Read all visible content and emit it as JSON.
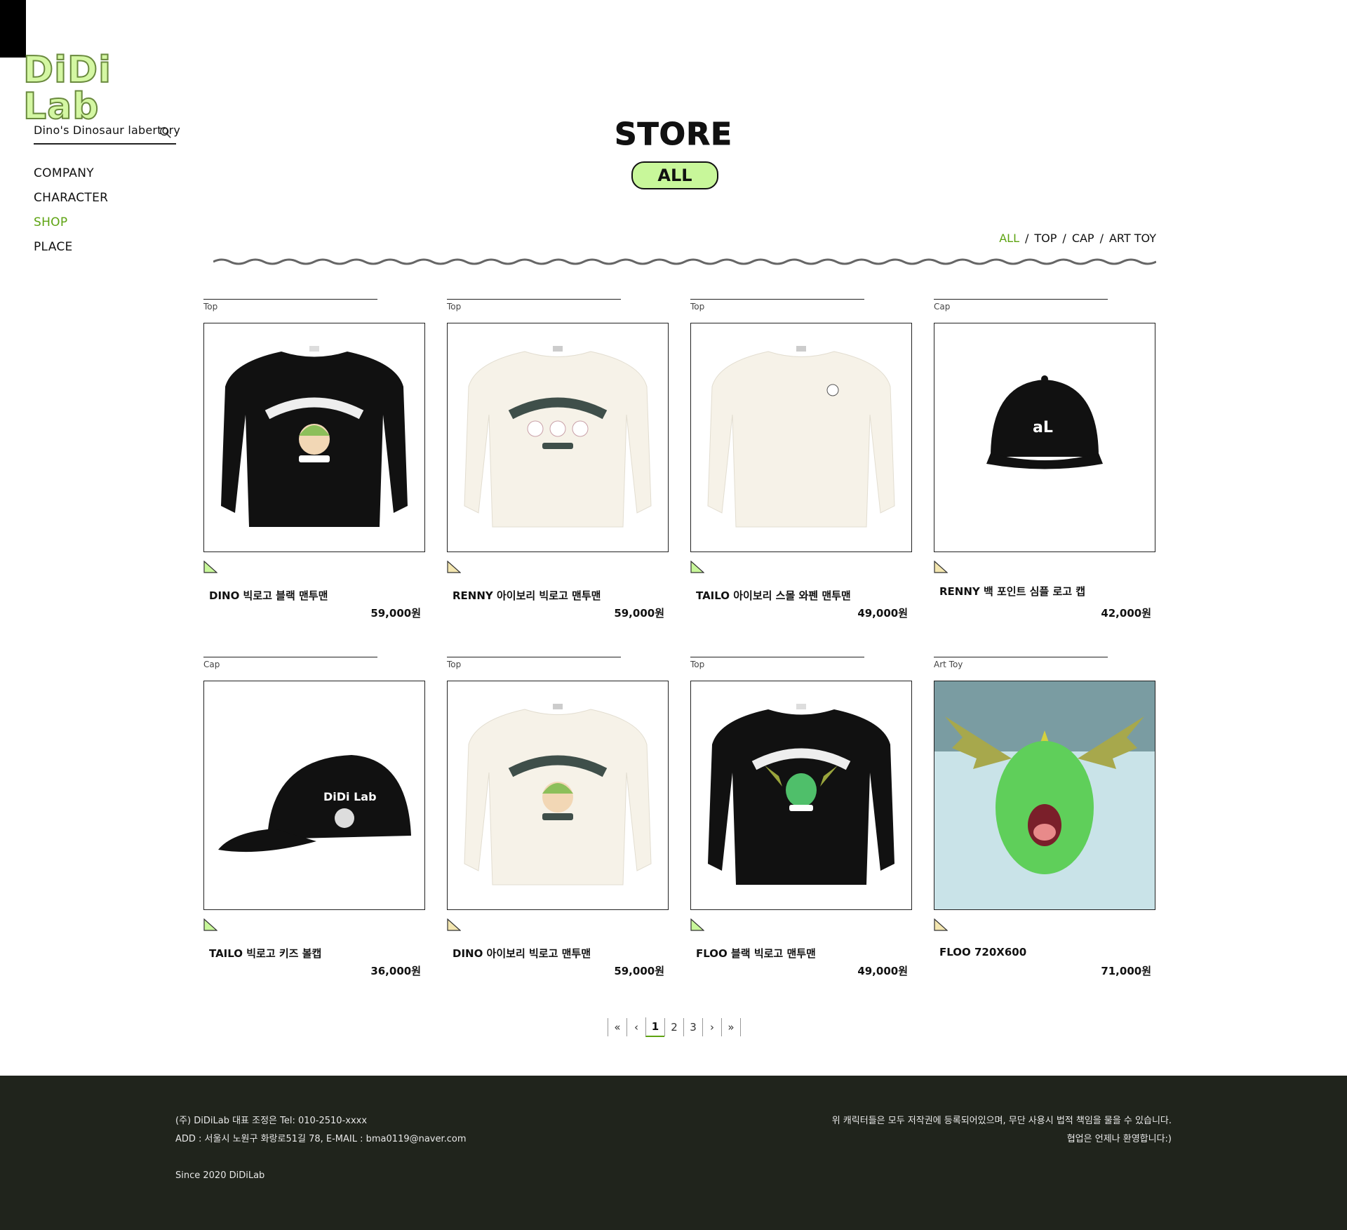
{
  "brand": {
    "logo_text": "DiDi Lab",
    "tagline": "Dino's Dinosaur labertory"
  },
  "search": {
    "placeholder": ""
  },
  "nav": [
    {
      "label": "COMPANY",
      "active": false
    },
    {
      "label": "CHARACTER",
      "active": false
    },
    {
      "label": "SHOP",
      "active": true
    },
    {
      "label": "PLACE",
      "active": false
    }
  ],
  "page": {
    "title": "STORE",
    "category_badge": "ALL"
  },
  "filters": [
    {
      "label": "ALL",
      "active": true
    },
    {
      "label": "TOP",
      "active": false
    },
    {
      "label": "CAP",
      "active": false
    },
    {
      "label": "ART TOY",
      "active": false
    }
  ],
  "products": [
    {
      "category": "Top",
      "name": "DINO 빅로고 블랙 맨투맨",
      "price": "59,000원",
      "image": "black-sweatshirt-dino",
      "tag_color": "#c8f79a"
    },
    {
      "category": "Top",
      "name": "RENNY 아이보리 빅로고 맨투맨",
      "price": "59,000원",
      "image": "ivory-sweatshirt-renny",
      "tag_color": "#f3e6b0"
    },
    {
      "category": "Top",
      "name": "TAILO 아이보리 스몰 와펜 맨투맨",
      "price": "49,000원",
      "image": "ivory-sweatshirt-tailo",
      "tag_color": "#c8f79a"
    },
    {
      "category": "Cap",
      "name": "RENNY 백 포인트 심플 로고 캡",
      "price": "42,000원",
      "image": "black-cap-logo",
      "tag_color": "#f3e6b0"
    },
    {
      "category": "Cap",
      "name": "TAILO 빅로고 키즈 볼캡",
      "price": "36,000원",
      "image": "black-cap-tailo",
      "tag_color": "#c8f79a"
    },
    {
      "category": "Top",
      "name": "DINO 아이보리 빅로고 맨투맨",
      "price": "59,000원",
      "image": "ivory-sweatshirt-dino",
      "tag_color": "#f3e6b0"
    },
    {
      "category": "Top",
      "name": "FLOO 블랙 빅로고 맨투맨",
      "price": "49,000원",
      "image": "black-sweatshirt-floo",
      "tag_color": "#c8f79a"
    },
    {
      "category": "Art Toy",
      "name": "FLOO 720X600",
      "price": "71,000원",
      "image": "floo-art-toy",
      "tag_color": "#f3e6b0"
    }
  ],
  "pagination": {
    "first": "«",
    "prev": "‹",
    "pages": [
      "1",
      "2",
      "3"
    ],
    "current": "1",
    "next": "›",
    "last": "»"
  },
  "footer": {
    "company": "(주) DiDiLab 대표 조정은 Tel: 010-2510-xxxx",
    "address": "ADD : 서울시 노원구 화랑로51길 78, E-MAIL : bma0119@naver.com",
    "since": "Since 2020 DiDiLab",
    "copyright_notice": "위 캐릭터들은 모두 저작권에 등록되어있으며, 무단 사용시 법적 책임을 물을 수 있습니다.",
    "collab": "협업은 언제나 환영합니다:)"
  }
}
